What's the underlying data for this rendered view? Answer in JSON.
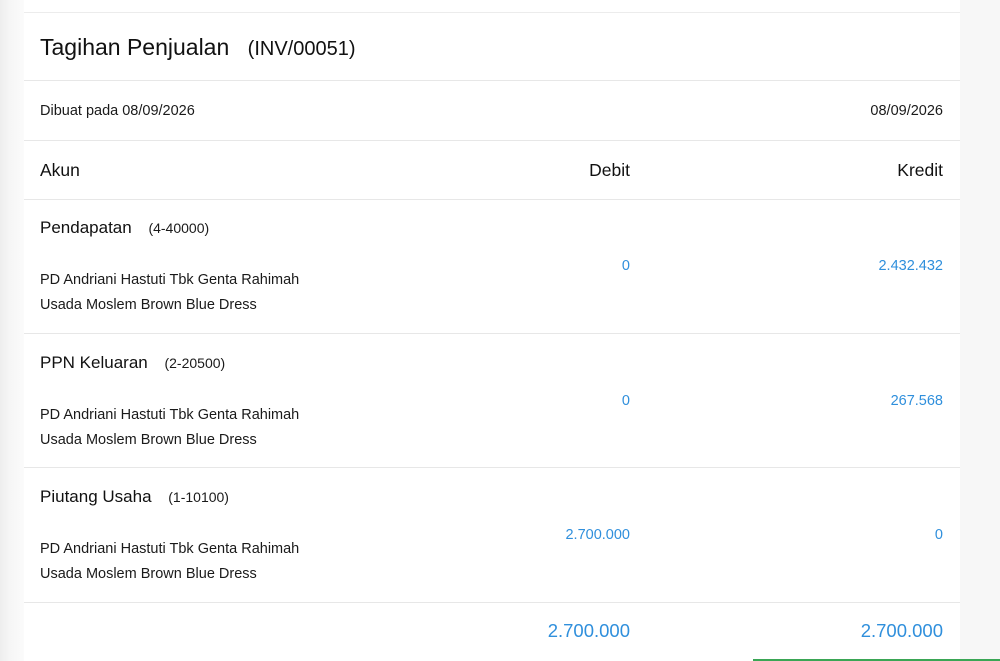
{
  "header": {
    "title": "Tagihan Penjualan",
    "invoice_code": "(INV/00051)"
  },
  "meta": {
    "created_label": "Dibuat pada 08/09/2026",
    "date": "08/09/2026"
  },
  "columns": {
    "account": "Akun",
    "debit": "Debit",
    "credit": "Kredit"
  },
  "entries": [
    {
      "account": "Pendapatan",
      "code": "(4-40000)",
      "description_line1": "PD Andriani Hastuti Tbk Genta Rahimah",
      "description_line2": "Usada Moslem Brown Blue Dress",
      "debit": "0",
      "credit": "2.432.432"
    },
    {
      "account": "PPN Keluaran",
      "code": "(2-20500)",
      "description_line1": "PD Andriani Hastuti Tbk Genta Rahimah",
      "description_line2": "Usada Moslem Brown Blue Dress",
      "debit": "0",
      "credit": "267.568"
    },
    {
      "account": "Piutang Usaha",
      "code": "(1-10100)",
      "description_line1": "PD Andriani Hastuti Tbk Genta Rahimah",
      "description_line2": "Usada Moslem Brown Blue Dress",
      "debit": "2.700.000",
      "credit": "0"
    }
  ],
  "totals": {
    "debit": "2.700.000",
    "credit": "2.700.000"
  },
  "colors": {
    "amount": "#2f8fdc",
    "accent": "#3aa655"
  }
}
